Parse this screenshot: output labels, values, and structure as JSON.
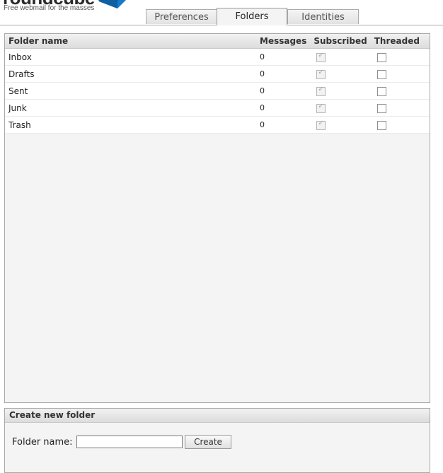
{
  "logo": {
    "wordmark": "roundcube",
    "tagline": "Free webmail for the masses"
  },
  "tabs": [
    {
      "label": "Preferences",
      "active": false
    },
    {
      "label": "Folders",
      "active": true
    },
    {
      "label": "Identities",
      "active": false
    }
  ],
  "folders": {
    "columns": [
      "Folder name",
      "Messages",
      "Subscribed",
      "Threaded"
    ],
    "rows": [
      {
        "name": "Inbox",
        "messages": "0",
        "subscribed": true,
        "threaded": false
      },
      {
        "name": "Drafts",
        "messages": "0",
        "subscribed": true,
        "threaded": false
      },
      {
        "name": "Sent",
        "messages": "0",
        "subscribed": true,
        "threaded": false
      },
      {
        "name": "Junk",
        "messages": "0",
        "subscribed": true,
        "threaded": false
      },
      {
        "name": "Trash",
        "messages": "0",
        "subscribed": true,
        "threaded": false
      }
    ]
  },
  "create_folder": {
    "title": "Create new folder",
    "label": "Folder name:",
    "input_value": "",
    "button_label": "Create"
  },
  "colors": {
    "panel_bg": "#f4f4f4",
    "border": "#a8a8a8",
    "logo_cube": "#1a7ac8"
  }
}
